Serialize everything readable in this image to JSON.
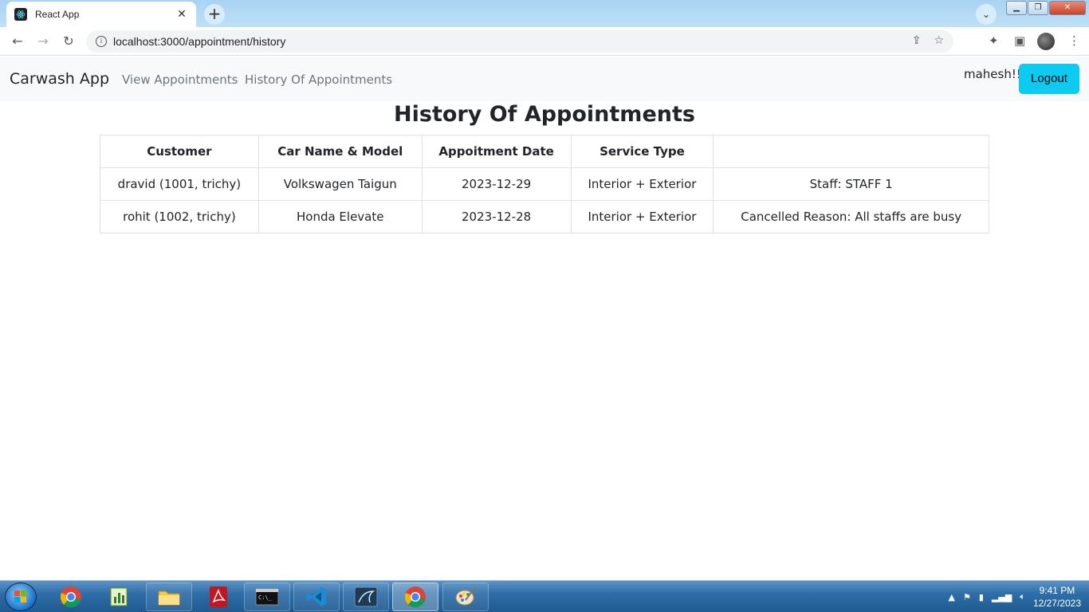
{
  "browser": {
    "tab_title": "React App",
    "tab_close": "✕",
    "new_tab": "+",
    "url": "localhost:3000/appointment/history"
  },
  "navbar": {
    "brand": "Carwash App",
    "links": [
      "View Appointments",
      "History Of Appointments"
    ],
    "user": "mahesh!!!",
    "logout_label": "Logout",
    "logout_color": "#0dcaf0"
  },
  "main": {
    "title": "History Of Appointments",
    "table": {
      "headers": [
        "Customer",
        "Car Name & Model",
        "Appoitment Date",
        "Service Type",
        ""
      ],
      "rows": [
        [
          "dravid (1001, trichy)",
          "Volkswagen Taigun",
          "2023-12-29",
          "Interior + Exterior",
          "Staff: STAFF 1"
        ],
        [
          "rohit (1002, trichy)",
          "Honda Elevate",
          "2023-12-28",
          "Interior + Exterior",
          "Cancelled Reason: All staffs are busy"
        ]
      ]
    }
  },
  "taskbar": {
    "apps": [
      "chrome-icon",
      "chart-icon",
      "folder-icon",
      "pdf-icon",
      "terminal-icon",
      "vscode-icon",
      "mysql-icon",
      "chrome-icon",
      "paint-icon"
    ],
    "time": "9:41 PM",
    "date": "12/27/2023"
  }
}
